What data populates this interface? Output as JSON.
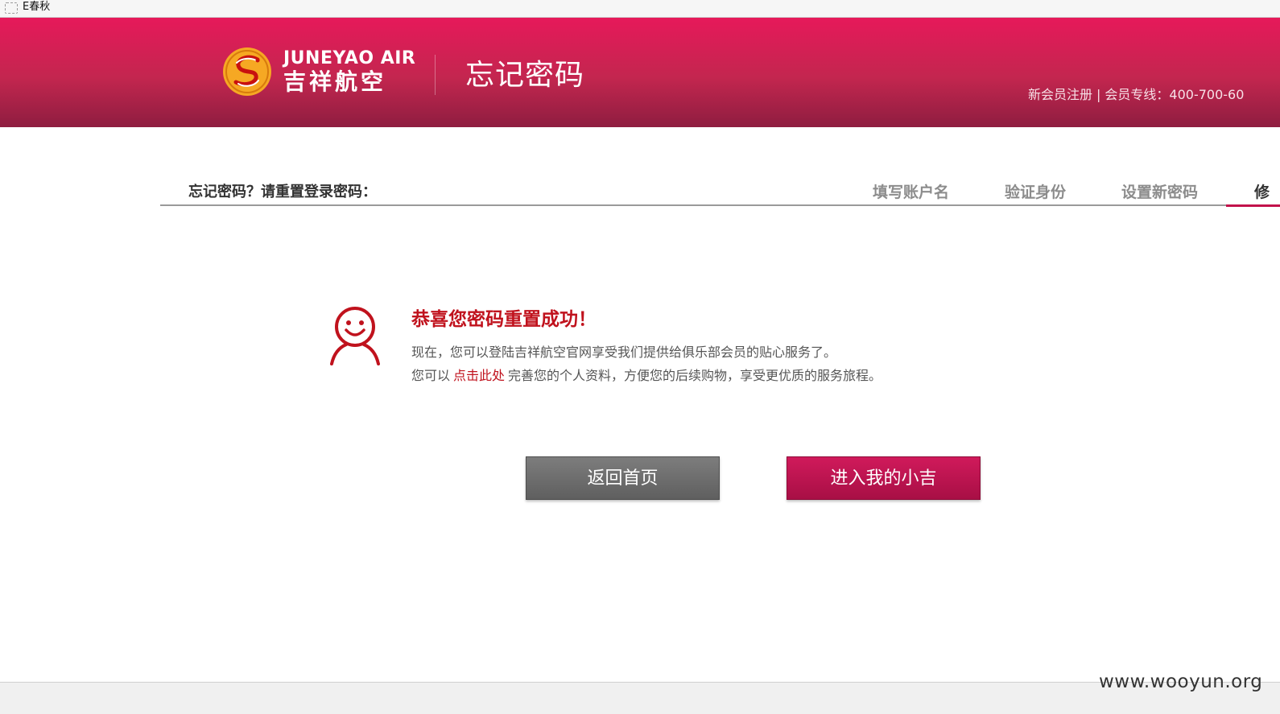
{
  "browser": {
    "tab_title": "E春秋"
  },
  "header": {
    "logo_en": "JUNEYAO AIR",
    "logo_cn": "吉祥航空",
    "page_title": "忘记密码",
    "register_link": "新会员注册",
    "separator": "|",
    "hotline": "会员专线：400-700-60"
  },
  "steps": {
    "title": "忘记密码？请重置登录密码：",
    "items": [
      "填写账户名",
      "验证身份",
      "设置新密码",
      "修"
    ]
  },
  "result": {
    "title": "恭喜您密码重置成功！",
    "line1": "现在，您可以登陆吉祥航空官网享受我们提供给俱乐部会员的贴心服务了。",
    "line2_prefix": "您可以",
    "line2_link": "点击此处",
    "line2_suffix": "完善您的个人资料，方便您的后续购物，享受更优质的服务旅程。"
  },
  "buttons": {
    "home": "返回首页",
    "my_account": "进入我的小吉"
  },
  "watermark": "www.wooyun.org",
  "colors": {
    "header_top": "#e6195a",
    "header_bottom": "#8e1d40",
    "accent_red": "#c0121d",
    "primary_button": "#c2124b",
    "secondary_button": "#6e6e6e"
  },
  "icons": {
    "logo": "dragon-emblem-icon",
    "success": "smile-person-icon"
  }
}
